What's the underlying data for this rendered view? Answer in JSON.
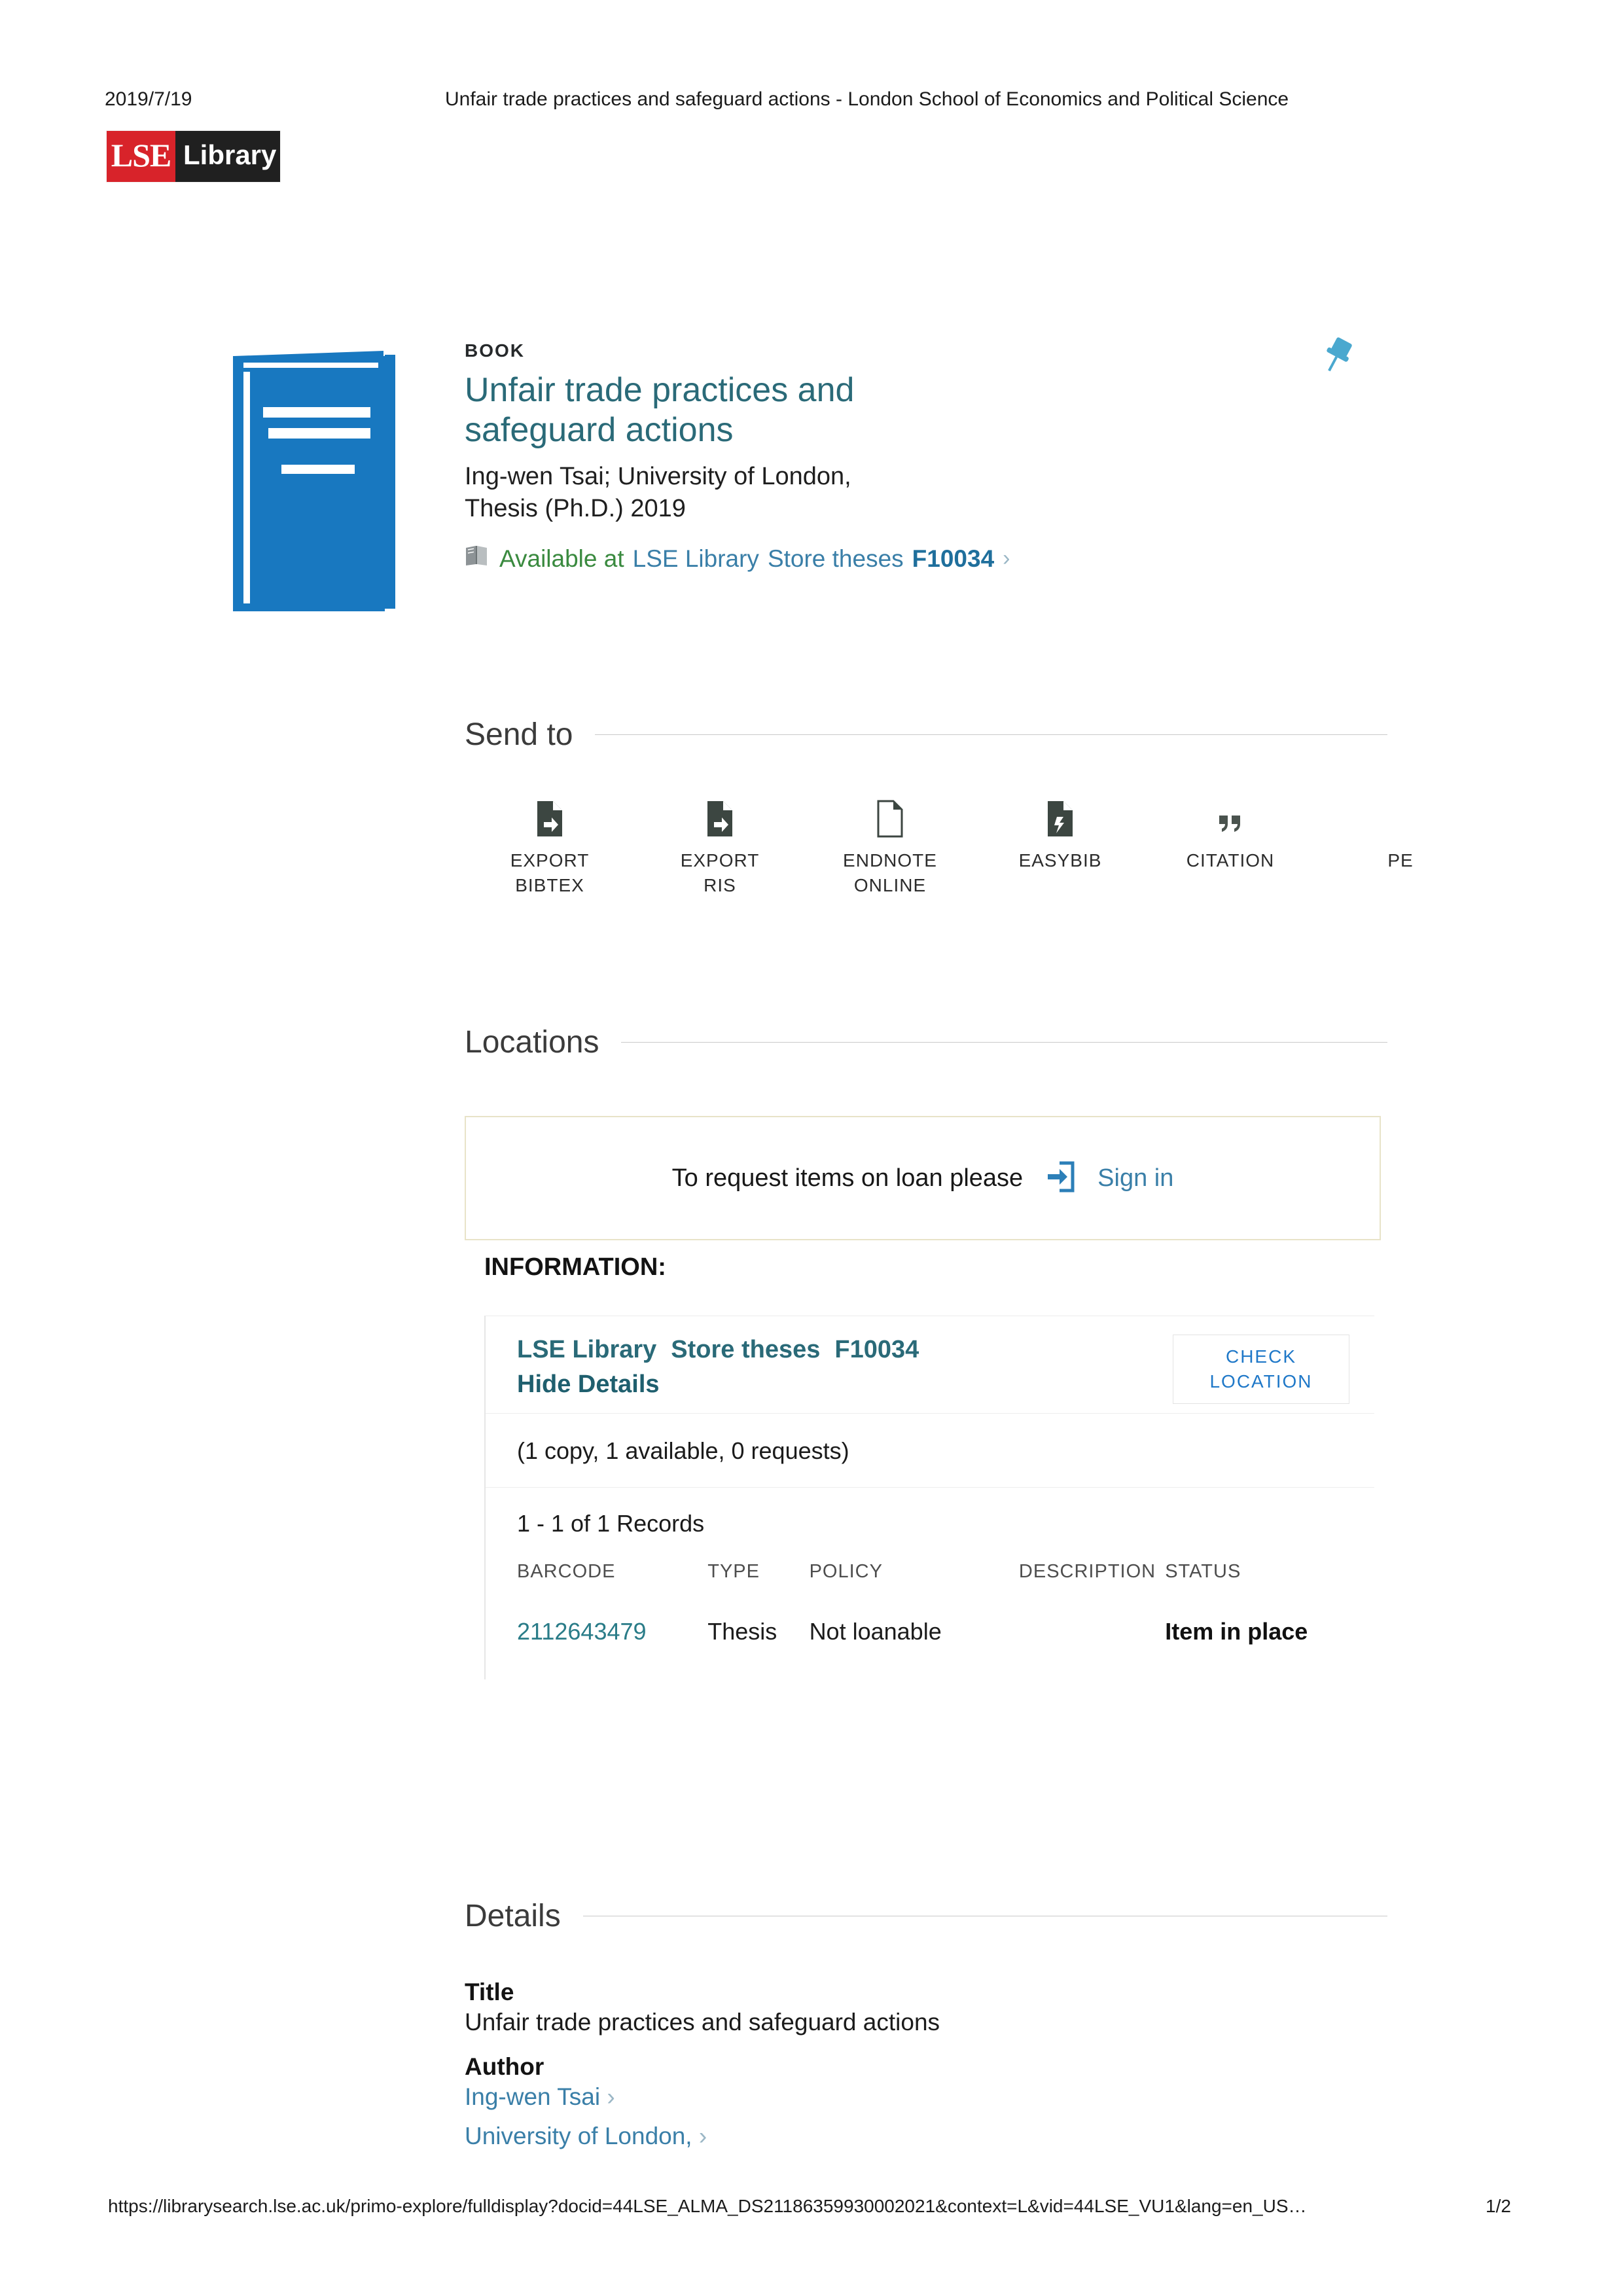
{
  "print_header": {
    "date": "2019/7/19",
    "page_title": "Unfair trade practices and safeguard actions - London School of Economics and Political Science"
  },
  "logo": {
    "primary": "LSE",
    "secondary": "Library"
  },
  "record": {
    "type_label": "BOOK",
    "title": "Unfair trade practices and safeguard actions",
    "contributors": "Ing-wen Tsai; University of London,",
    "format_year": "Thesis (Ph.D.) 2019",
    "availability": {
      "status": "Available at",
      "library": "LSE Library",
      "collection": "Store theses",
      "call_number": "F10034",
      "chevron": "›",
      "icon": "open-book-icon"
    },
    "pin_icon": "pushpin-icon",
    "cover_icon": "book-cover-icon"
  },
  "send_to": {
    "heading": "Send to",
    "items": [
      {
        "label": "EXPORT\nBIBTEX",
        "icon": "export-file-icon"
      },
      {
        "label": "EXPORT\nRIS",
        "icon": "export-file-icon"
      },
      {
        "label": "ENDNOTE\nONLINE",
        "icon": "document-icon"
      },
      {
        "label": "EASYBIB",
        "icon": "export-file-icon"
      },
      {
        "label": "CITATION",
        "icon": "quote-icon"
      },
      {
        "label": "PE",
        "icon": "permalink-icon"
      }
    ]
  },
  "locations": {
    "heading": "Locations",
    "signin_prompt": "To request items on loan please",
    "signin_label": "Sign in",
    "signin_icon": "sign-in-icon"
  },
  "information": {
    "heading": "INFORMATION:",
    "location_library": "LSE Library",
    "location_collection": "Store theses",
    "location_call_number": "F10034",
    "toggle_details_label": "Hide Details",
    "check_location_label": "CHECK\nLOCATION",
    "copies_summary": "(1 copy, 1 available, 0 requests)",
    "records_count": "1 - 1 of 1 Records",
    "table": {
      "columns": [
        "BARCODE",
        "TYPE",
        "POLICY",
        "DESCRIPTION",
        "STATUS"
      ],
      "rows": [
        {
          "barcode": "2112643479",
          "type": "Thesis",
          "policy": "Not loanable",
          "description": "",
          "status": "Item in place"
        }
      ]
    }
  },
  "details": {
    "heading": "Details",
    "fields": [
      {
        "label": "Title",
        "value": "Unfair trade practices and safeguard actions",
        "is_link": false
      },
      {
        "label": "Author",
        "value": "",
        "is_link": false
      }
    ],
    "author_links": [
      {
        "text": "Ing-wen Tsai",
        "chevron": "›"
      },
      {
        "text": "University of London,",
        "chevron": "›"
      }
    ]
  },
  "print_footer": {
    "url": "https://librarysearch.lse.ac.uk/primo-explore/fulldisplay?docid=44LSE_ALMA_DS21186359930002021&context=L&vid=44LSE_VU1&lang=en_US…",
    "page_number": "1/2"
  },
  "colors": {
    "brand_red": "#d8232a",
    "brand_dark": "#202020",
    "title_teal": "#2a6a78",
    "link_blue": "#3a7fa8",
    "available_green": "#3a8a3f",
    "book_blue": "#1878c0",
    "signin_box_border": "#e8e3c8"
  }
}
